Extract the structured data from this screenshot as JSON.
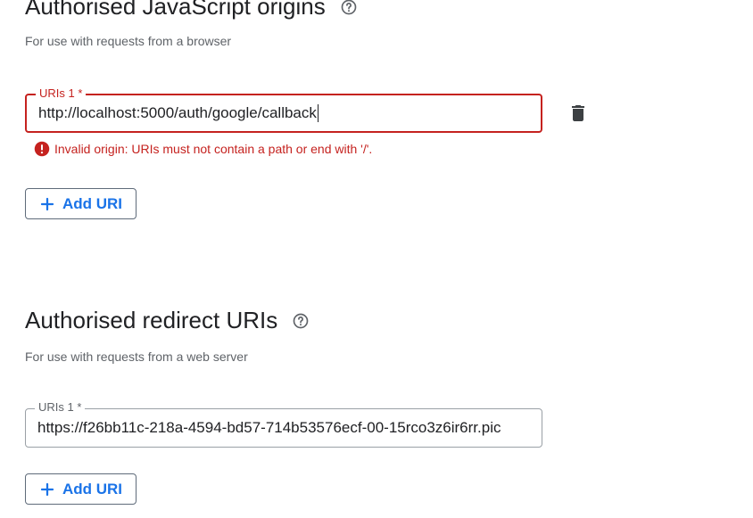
{
  "js_origins": {
    "title": "Authorised JavaScript origins",
    "help_icon": "help-circle-icon",
    "subtitle": "For use with requests from a browser",
    "uri_field": {
      "label": "URIs 1 *",
      "value": "http://localhost:5000/auth/google/callback",
      "state": "error"
    },
    "delete_icon": "trash-icon",
    "error_icon": "error-icon",
    "error_message": "Invalid origin: URIs must not contain a path or end with '/'.",
    "add_button_label": "Add URI",
    "add_button_icon": "plus-icon"
  },
  "redirect_uris": {
    "title": "Authorised redirect URIs",
    "help_icon": "help-circle-icon",
    "subtitle": "For use with requests from a web server",
    "uri_field": {
      "label": "URIs 1 *",
      "value": "https://f26bb11c-218a-4594-bd57-714b53576ecf-00-15rco3z6ir6rr.pic"
    },
    "add_button_label": "Add URI",
    "add_button_icon": "plus-icon"
  },
  "colors": {
    "error": "#c5221f",
    "primary": "#1a73e8",
    "text": "#202124",
    "secondary_text": "#5f6368"
  }
}
